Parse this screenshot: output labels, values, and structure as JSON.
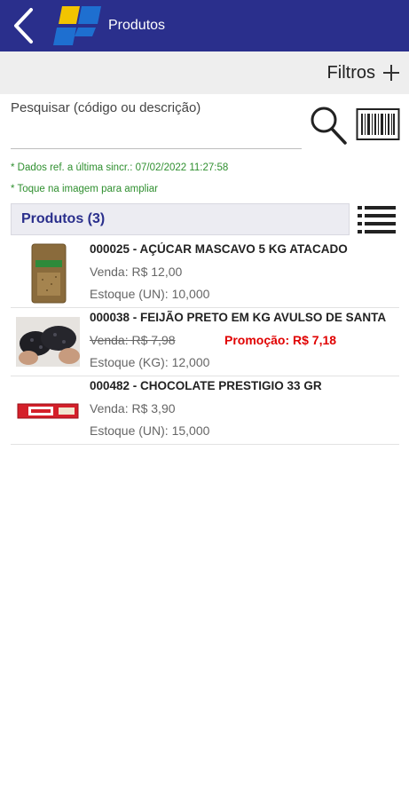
{
  "header": {
    "title": "Produtos",
    "background": "#2a2f8c"
  },
  "toolbar": {
    "filters_label": "Filtros"
  },
  "search": {
    "placeholder": "Pesquisar (código ou descrição)",
    "value": ""
  },
  "notes": {
    "sync": "* Dados ref. a última sincr.: 07/02/2022 11:27:58",
    "tip": "* Toque na imagem para ampliar"
  },
  "section": {
    "title": "Produtos (3)"
  },
  "products": [
    {
      "name": "000025 - AÇÚCAR MASCAVO 5 KG ATACADO",
      "price_label": "Venda: R$ 12,00",
      "promo_label": "",
      "stock_label": "Estoque (UN): 10,000",
      "thumb_icon": "sugar-bag-image"
    },
    {
      "name": "000038 - FEIJÃO PRETO EM KG AVULSO DE SANTA",
      "price_label": "Venda: R$ 7,98",
      "promo_label": "Promoção: R$ 7,18",
      "stock_label": "Estoque (KG): 12,000",
      "thumb_icon": "black-beans-image"
    },
    {
      "name": "000482 - CHOCOLATE PRESTIGIO 33 GR",
      "price_label": "Venda: R$ 3,90",
      "promo_label": "",
      "stock_label": "Estoque (UN): 15,000",
      "thumb_icon": "chocolate-bar-image"
    }
  ],
  "colors": {
    "accent": "#2a2f8c",
    "note_green": "#2f8f2f",
    "promo_red": "#e00000"
  }
}
